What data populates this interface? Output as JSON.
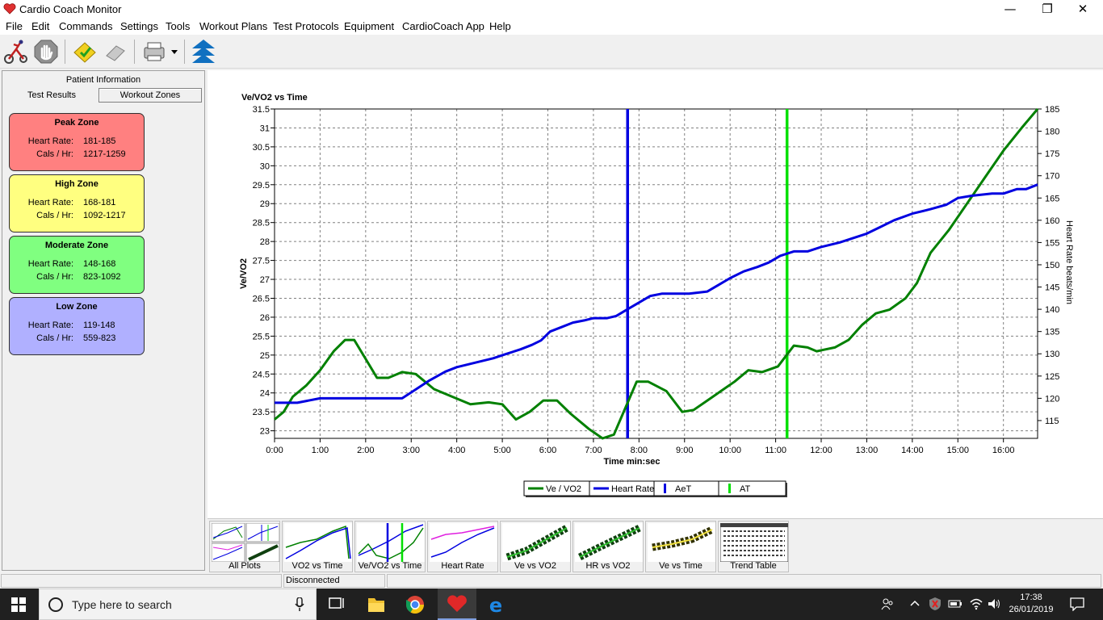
{
  "window": {
    "title": "Cardio Coach Monitor",
    "minimize_glyph": "—",
    "maximize_glyph": "❐",
    "close_glyph": "✕"
  },
  "menu": [
    "File",
    "Edit",
    "Commands",
    "Settings",
    "Tools",
    "Workout Plans",
    "Test Protocols",
    "Equipment",
    "CardioCoach App",
    "Help"
  ],
  "left_panel": {
    "patient_tab": "Patient Information",
    "tabs": [
      "Test Results",
      "Workout Zones"
    ],
    "active_tab": "Workout Zones",
    "zones": [
      {
        "name": "Peak Zone",
        "hr_label": "Heart Rate:",
        "hr": "181-185",
        "cal_label": "Cals / Hr:",
        "cal": "1217-1259",
        "color": "#ff8080"
      },
      {
        "name": "High Zone",
        "hr_label": "Heart Rate:",
        "hr": "168-181",
        "cal_label": "Cals / Hr:",
        "cal": "1092-1217",
        "color": "#ffff80"
      },
      {
        "name": "Moderate Zone",
        "hr_label": "Heart Rate:",
        "hr": "148-168",
        "cal_label": "Cals / Hr:",
        "cal": "823-1092",
        "color": "#80ff80"
      },
      {
        "name": "Low Zone",
        "hr_label": "Heart Rate:",
        "hr": "119-148",
        "cal_label": "Cals / Hr:",
        "cal": "559-823",
        "color": "#b0b0ff"
      }
    ]
  },
  "chart_data": {
    "type": "line",
    "title": "Ve/VO2 vs Time",
    "xlabel": "Time min:sec",
    "ylabel": "Ve/VO2",
    "y2label": "Heart Rate beats/min",
    "xlim": [
      0,
      16.75
    ],
    "ylim": [
      22.8,
      31.5
    ],
    "y2lim": [
      111,
      185
    ],
    "x_ticks": [
      "0:00",
      "1:00",
      "2:00",
      "3:00",
      "4:00",
      "5:00",
      "6:00",
      "7:00",
      "8:00",
      "9:00",
      "10:00",
      "11:00",
      "12:00",
      "13:00",
      "14:00",
      "15:00",
      "16:00"
    ],
    "y_ticks": [
      23,
      23.5,
      24,
      24.5,
      25,
      25.5,
      26,
      26.5,
      27,
      27.5,
      28,
      28.5,
      29,
      29.5,
      30,
      30.5,
      31,
      31.5
    ],
    "y2_ticks": [
      115,
      120,
      125,
      130,
      135,
      140,
      145,
      150,
      155,
      160,
      165,
      170,
      175,
      180,
      185
    ],
    "grid": true,
    "legend_position": "bottom-center",
    "series": [
      {
        "name": "Ve / VO2",
        "axis": "left",
        "color": "#008000",
        "x": [
          0,
          0.2,
          0.4,
          0.7,
          1.0,
          1.3,
          1.55,
          1.75,
          2.0,
          2.25,
          2.5,
          2.8,
          3.1,
          3.5,
          3.9,
          4.3,
          4.7,
          5.0,
          5.3,
          5.6,
          5.9,
          6.2,
          6.5,
          6.9,
          7.2,
          7.45,
          7.7,
          7.95,
          8.2,
          8.6,
          8.95,
          9.2,
          9.5,
          9.8,
          10.1,
          10.4,
          10.7,
          11.05,
          11.4,
          11.7,
          11.9,
          12.3,
          12.6,
          12.9,
          13.2,
          13.5,
          13.85,
          14.1,
          14.4,
          14.8,
          15.2,
          15.6,
          16.0,
          16.4,
          16.75
        ],
        "values": [
          23.3,
          23.5,
          23.9,
          24.2,
          24.6,
          25.1,
          25.4,
          25.4,
          24.9,
          24.4,
          24.4,
          24.55,
          24.5,
          24.1,
          23.9,
          23.7,
          23.75,
          23.7,
          23.3,
          23.5,
          23.8,
          23.8,
          23.45,
          23.05,
          22.8,
          22.9,
          23.6,
          24.3,
          24.3,
          24.05,
          23.5,
          23.55,
          23.8,
          24.05,
          24.3,
          24.6,
          24.55,
          24.7,
          25.25,
          25.2,
          25.1,
          25.2,
          25.4,
          25.8,
          26.1,
          26.2,
          26.5,
          26.9,
          27.7,
          28.3,
          29.0,
          29.7,
          30.4,
          31.0,
          31.5
        ]
      },
      {
        "name": "Heart Rate",
        "axis": "right",
        "color": "#0000e0",
        "x": [
          0,
          0.5,
          1.0,
          1.5,
          2.0,
          2.5,
          2.8,
          3.1,
          3.4,
          3.75,
          4.0,
          4.4,
          4.8,
          5.1,
          5.4,
          5.65,
          5.85,
          6.05,
          6.3,
          6.55,
          6.8,
          7.0,
          7.3,
          7.5,
          7.75,
          8.0,
          8.25,
          8.5,
          8.8,
          9.1,
          9.5,
          9.75,
          10.0,
          10.3,
          10.6,
          10.85,
          11.1,
          11.4,
          11.7,
          12.0,
          12.4,
          12.7,
          13.0,
          13.3,
          13.6,
          14.0,
          14.4,
          14.75,
          15.0,
          15.3,
          15.75,
          16.0,
          16.3,
          16.5,
          16.75
        ],
        "values": [
          119,
          119,
          120,
          120,
          120,
          120,
          120,
          122,
          124,
          126,
          127,
          128,
          129,
          130,
          131,
          132,
          133,
          135,
          136,
          137,
          137.5,
          138,
          138,
          138.5,
          140,
          141.5,
          143,
          143.5,
          143.5,
          143.5,
          144,
          145.5,
          147,
          148.5,
          149.5,
          150.5,
          152,
          153,
          153,
          154,
          155,
          156,
          157,
          158.5,
          160,
          161.5,
          162.5,
          163.5,
          165,
          165.5,
          166,
          166,
          167,
          167,
          168
        ]
      }
    ],
    "markers": [
      {
        "name": "AeT",
        "x": 7.75,
        "color": "#0000e0"
      },
      {
        "name": "AT",
        "x": 11.25,
        "color": "#00e000"
      }
    ]
  },
  "thumbnails": [
    {
      "label": "All Plots",
      "icon": "all-plots-icon"
    },
    {
      "label": "VO2 vs Time",
      "icon": "vo2-time-icon"
    },
    {
      "label": "Ve/VO2 vs Time",
      "icon": "vevo2-time-icon"
    },
    {
      "label": "Heart Rate",
      "icon": "heart-rate-icon"
    },
    {
      "label": "Ve vs VO2",
      "icon": "ve-vo2-icon"
    },
    {
      "label": "HR vs VO2",
      "icon": "hr-vo2-icon"
    },
    {
      "label": "Ve vs Time",
      "icon": "ve-time-icon"
    },
    {
      "label": "Trend Table",
      "icon": "trend-table-icon"
    }
  ],
  "status": {
    "connection": "Disconnected"
  },
  "taskbar": {
    "search_placeholder": "Type here to search",
    "time": "17:38",
    "date": "26/01/2019"
  }
}
